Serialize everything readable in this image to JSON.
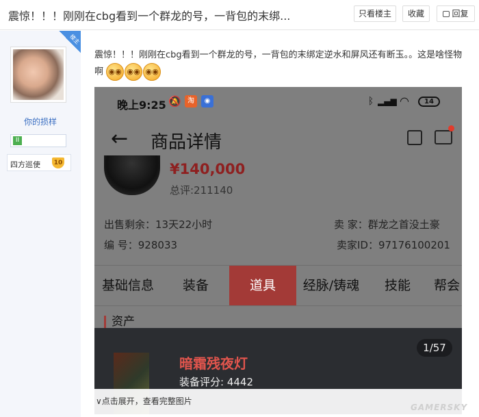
{
  "header": {
    "title": "震惊！！！刚刚在cbg看到一个群龙的号，一背包的末绑...",
    "only_op_label": "只看楼主",
    "favorite_label": "收藏",
    "reply_label": "回复"
  },
  "sidebar": {
    "op_badge": "楼主",
    "username": "你的损样",
    "level_icon": "II",
    "rank_label": "四方巡使",
    "rank_level": "10"
  },
  "post": {
    "text": "震惊！！！刚刚在cbg看到一个群龙的号，一背包的末绑定逆水和屏风还有断玉。。这是啥怪物啊",
    "emojis": [
      "shocked-emoji",
      "shocked-emoji",
      "shocked-emoji"
    ]
  },
  "phone": {
    "time": "晚上9:25",
    "battery": "14",
    "page_title": "商品详情",
    "price": "¥140,000",
    "rating": "总评:211140",
    "sale_remaining": "出售剩余：13天22小时",
    "item_number": "编  号：928033",
    "seller": "卖  家：群龙之首没土豪",
    "seller_id": "卖家ID：97176100201",
    "tabs": [
      "基础信息",
      "装备",
      "道具",
      "经脉/铸魂",
      "技能",
      "帮会"
    ],
    "active_tab": "道具",
    "section_title": "资产",
    "gallery_counter": "1/57",
    "equip_name": "暗霜残夜灯",
    "equip_score": "装备评分: 4442"
  },
  "expand_text": "∨点击展开，查看完整图片",
  "watermark": "GAMERSKY",
  "colors": {
    "accent_red": "#a33a37",
    "link_blue": "#3b6fc2",
    "badge_blue": "#4a90e2"
  }
}
